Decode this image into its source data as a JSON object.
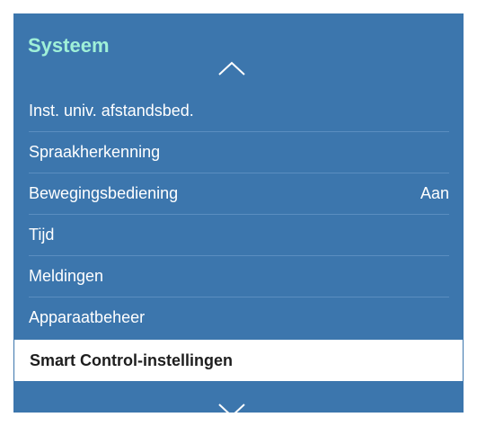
{
  "menu": {
    "title": "Systeem",
    "items": [
      {
        "label": "Inst. univ. afstandsbed.",
        "value": ""
      },
      {
        "label": "Spraakherkenning",
        "value": ""
      },
      {
        "label": "Bewegingsbediening",
        "value": "Aan"
      },
      {
        "label": "Tijd",
        "value": ""
      },
      {
        "label": "Meldingen",
        "value": ""
      },
      {
        "label": "Apparaatbeheer",
        "value": ""
      },
      {
        "label": "Smart Control-instellingen",
        "value": ""
      }
    ],
    "selected_index": 6,
    "colors": {
      "panel": "#3c76ad",
      "title": "#9ff0d8",
      "selected_bg": "#ffffff"
    },
    "icons": [
      "chevron-up-icon",
      "chevron-down-icon"
    ]
  }
}
